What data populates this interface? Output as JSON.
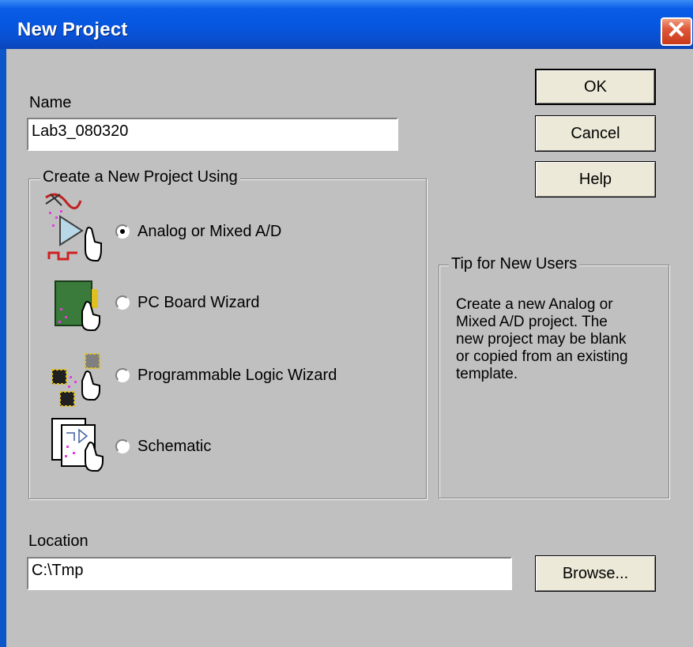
{
  "window": {
    "title": "New Project",
    "close_glyph": "✕"
  },
  "name_field": {
    "label": "Name",
    "value": "Lab3_080320"
  },
  "buttons": {
    "ok": "OK",
    "cancel": "Cancel",
    "help": "Help",
    "browse": "Browse..."
  },
  "create_group": {
    "title": "Create a New Project Using",
    "options": [
      {
        "label": "Analog or Mixed A/D",
        "icon": "analog-mixed-icon",
        "checked": true
      },
      {
        "label": "PC Board Wizard",
        "icon": "pc-board-icon",
        "checked": false
      },
      {
        "label": "Programmable Logic Wizard",
        "icon": "programmable-logic-icon",
        "checked": false
      },
      {
        "label": "Schematic",
        "icon": "schematic-icon",
        "checked": false
      }
    ]
  },
  "tip_group": {
    "title": "Tip for New Users",
    "text": "Create a new Analog or\nMixed A/D project.  The\nnew project may be blank\nor copied from an existing\ntemplate."
  },
  "location_field": {
    "label": "Location",
    "value": "C:\\Tmp"
  },
  "colors": {
    "titlebar": "#0657e0",
    "client": "#c0c0c0",
    "close": "#e0573a"
  }
}
